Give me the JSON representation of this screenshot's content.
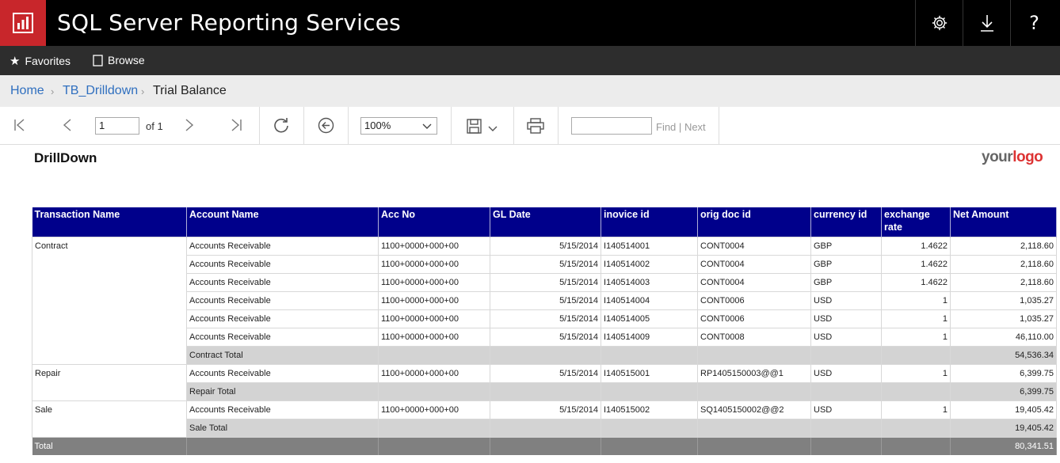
{
  "app": {
    "title": "SQL Server Reporting Services"
  },
  "nav": {
    "favorites": "Favorites",
    "browse": "Browse"
  },
  "breadcrumb": {
    "home": "Home",
    "folder": "TB_Drilldown",
    "current": "Trial Balance"
  },
  "toolbar": {
    "page_value": "1",
    "page_of": "of 1",
    "zoom": "100%",
    "find_label": "Find",
    "find_sep": "|",
    "next_label": "Next"
  },
  "report": {
    "title": "DrillDown",
    "logo_left": "your",
    "logo_right": "logo",
    "columns": [
      "Transaction Name",
      "Account Name",
      "Acc No",
      "GL Date",
      "inovice id",
      "orig doc id",
      "currency id",
      "exchange rate",
      "Net Amount"
    ],
    "groups": [
      {
        "name": "Contract",
        "rows": [
          [
            "Accounts Receivable",
            "1100+0000+000+00",
            "5/15/2014",
            "I140514001",
            "CONT0004",
            "GBP",
            "1.4622",
            "2,118.60"
          ],
          [
            "Accounts Receivable",
            "1100+0000+000+00",
            "5/15/2014",
            "I140514002",
            "CONT0004",
            "GBP",
            "1.4622",
            "2,118.60"
          ],
          [
            "Accounts Receivable",
            "1100+0000+000+00",
            "5/15/2014",
            "I140514003",
            "CONT0004",
            "GBP",
            "1.4622",
            "2,118.60"
          ],
          [
            "Accounts Receivable",
            "1100+0000+000+00",
            "5/15/2014",
            "I140514004",
            "CONT0006",
            "USD",
            "1",
            "1,035.27"
          ],
          [
            "Accounts Receivable",
            "1100+0000+000+00",
            "5/15/2014",
            "I140514005",
            "CONT0006",
            "USD",
            "1",
            "1,035.27"
          ],
          [
            "Accounts Receivable",
            "1100+0000+000+00",
            "5/15/2014",
            "I140514009",
            "CONT0008",
            "USD",
            "1",
            "46,110.00"
          ]
        ],
        "total_label": "Contract Total",
        "total_value": "54,536.34"
      },
      {
        "name": "Repair",
        "rows": [
          [
            "Accounts Receivable",
            "1100+0000+000+00",
            "5/15/2014",
            "I140515001",
            "RP1405150003@@1",
            "USD",
            "1",
            "6,399.75"
          ]
        ],
        "total_label": "Repair Total",
        "total_value": "6,399.75"
      },
      {
        "name": "Sale",
        "rows": [
          [
            "Accounts Receivable",
            "1100+0000+000+00",
            "5/15/2014",
            "I140515002",
            "SQ1405150002@@2",
            "USD",
            "1",
            "19,405.42"
          ]
        ],
        "total_label": "Sale Total",
        "total_value": "19,405.42"
      }
    ],
    "grand_total_label": "Total",
    "grand_total_value": "80,341.51"
  },
  "colors": {
    "header_bg": "#00008b",
    "brand_red": "#c8262b",
    "link": "#2f6fbf",
    "subtotal_bg": "#d3d3d3",
    "total_bg": "#808080"
  },
  "icons": [
    "report-logo-icon",
    "gear-icon",
    "download-icon",
    "help-icon",
    "star-icon",
    "browse-icon",
    "first-page-icon",
    "prev-page-icon",
    "next-page-icon",
    "last-page-icon",
    "refresh-icon",
    "back-icon",
    "save-icon",
    "print-icon"
  ]
}
